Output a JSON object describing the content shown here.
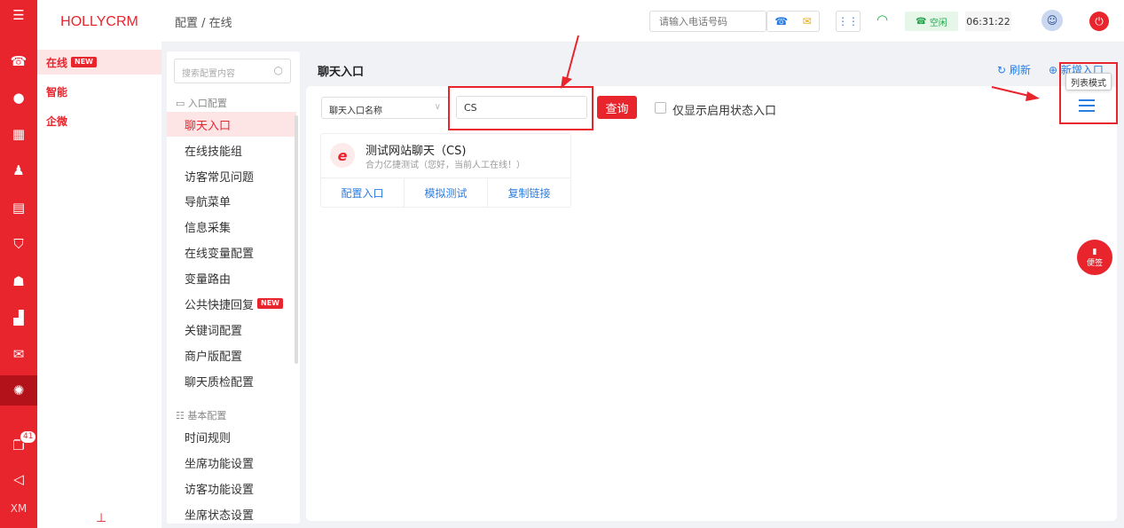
{
  "app": {
    "logo": "HOLLYCRM"
  },
  "rail": {
    "icons": [
      "phone-icon",
      "chat-icon",
      "grid-icon",
      "user-icon",
      "clipboard-icon",
      "shield-icon",
      "robot-icon",
      "bar-chart-icon",
      "comment-icon",
      "gear-icon",
      "book-icon",
      "megaphone-icon"
    ],
    "badge": "41",
    "bottom_label": "XM"
  },
  "modules": [
    {
      "label": "在线",
      "tag": "NEW"
    },
    {
      "label": "智能"
    },
    {
      "label": "企微"
    }
  ],
  "header": {
    "breadcrumb": "配置 / 在线",
    "phone_placeholder": "请输入电话号码",
    "status": "空闲",
    "timer": "06:31:22"
  },
  "submenu": {
    "search_placeholder": "搜索配置内容",
    "groups": [
      {
        "title": "入口配置",
        "items": [
          "聊天入口",
          "在线技能组",
          "访客常见问题",
          "导航菜单",
          "信息采集",
          "在线变量配置",
          "变量路由",
          "公共快捷回复",
          "关键词配置",
          "商户版配置",
          "聊天质检配置"
        ]
      },
      {
        "title": "基本配置",
        "items": [
          "时间规则",
          "坐席功能设置",
          "访客功能设置",
          "坐席状态设置"
        ]
      }
    ],
    "new_tag": "NEW"
  },
  "main": {
    "title": "聊天入口",
    "refresh": "刷新",
    "add_new": "新增入口",
    "filter_select": "聊天入口名称",
    "query_value": "CS",
    "query_button": "查询",
    "only_enabled_label": "仅显示启用状态入口",
    "tooltip": "列表模式"
  },
  "cards": [
    {
      "title": "测试网站聊天（CS)",
      "subtitle": "合力亿捷测试（您好，当前人工在线！）",
      "actions": [
        "配置入口",
        "模拟测试",
        "复制链接"
      ]
    }
  ],
  "float_button": "便签",
  "colors": {
    "brand": "#e8242d",
    "link": "#2a7de1",
    "online": "#22b14c"
  }
}
